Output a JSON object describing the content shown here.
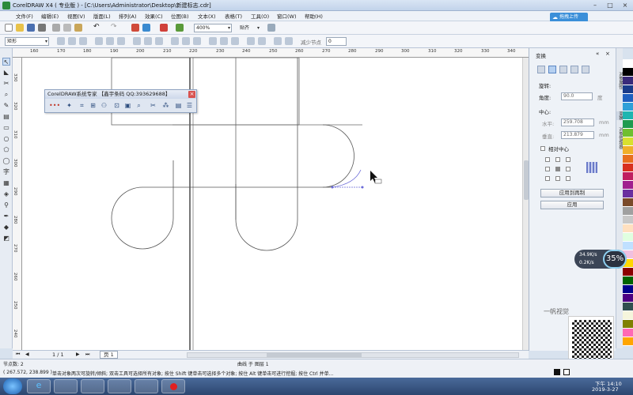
{
  "window": {
    "title": "CorelDRAW X4 ( 专业版 ) - [C:\\Users\\Administrator\\Desktop\\新建标志.cdr]",
    "controls": [
      "–",
      "□",
      "×"
    ]
  },
  "menubar": {
    "items": [
      "文件(F)",
      "编辑(E)",
      "视图(V)",
      "版面(L)",
      "排列(A)",
      "效果(C)",
      "位图(B)",
      "文本(X)",
      "表格(T)",
      "工具(O)",
      "窗口(W)",
      "帮助(H)"
    ]
  },
  "toolbar": {
    "zoom": "400%",
    "snap": "贴齐"
  },
  "propertybar": {
    "object_type": "矩形",
    "nudge_label": "减少节点",
    "nudge_value": "0"
  },
  "upload_button": "拖拽上传",
  "ruler": {
    "h_ticks": [
      "160",
      "170",
      "180",
      "190",
      "200",
      "210",
      "220",
      "230",
      "240",
      "250",
      "260",
      "270",
      "280",
      "290",
      "300",
      "310",
      "320",
      "330",
      "340"
    ],
    "v_ticks": [
      "330",
      "320",
      "310",
      "300",
      "290",
      "280",
      "270",
      "260",
      "250",
      "240"
    ]
  },
  "floating_toolbar": {
    "title": "CorelDRAW系统专家   【鑫宇条码 QQ:393629688】"
  },
  "docker": {
    "title": "变换",
    "rotate_label": "旋转:",
    "angle_label": "角度:",
    "angle_value": "90.0",
    "angle_unit": "度",
    "center_label": "中心:",
    "h_label": "水平:",
    "h_value": "259.708",
    "v_label": "垂直:",
    "v_value": "213.879",
    "unit": "mm",
    "relative_center": "相对中心",
    "apply_to_duplicate": "应用到再制",
    "apply": "应用"
  },
  "side_tabs": [
    "对象属性",
    "变换",
    "对象管理器"
  ],
  "palette_colors": [
    "#ffffff",
    "#000000",
    "#3a2a7a",
    "#1a3b8a",
    "#1f5fbf",
    "#2fa0d8",
    "#1fb5b0",
    "#1f9b4f",
    "#6fbf2f",
    "#d8e02f",
    "#f0b02a",
    "#e8701f",
    "#d8301f",
    "#c01f5f",
    "#a01f8f",
    "#6a2f9f",
    "#7a4a2a",
    "#a0a0a0",
    "#c8c8c8",
    "#ffe0c0",
    "#e0ffe0",
    "#c0e0ff",
    "#f0c0e0",
    "#ffd700",
    "#8b0000",
    "#006400",
    "#00008b",
    "#4b0082",
    "#2f4f4f",
    "#f5f5dc",
    "#808000",
    "#ff69b4",
    "#ffa500"
  ],
  "page_nav": {
    "counter": "1 / 1",
    "tab": "页 1"
  },
  "status": {
    "nodes": "节点数: 2",
    "object": "曲线 于 图层 1",
    "coords": "( 267.572, 238.899 )",
    "hint": "单击对象两次可旋转/倾斜; 双击工具可选择所有对象; 按住 Shift 键单击可选择多个对象; 按住 Alt 键单击可进行挖掘; 按住 Ctrl 并单..."
  },
  "perf_widget": {
    "up": "34.9K/s",
    "down": "0.2K/s",
    "percent": "35%"
  },
  "watermark": "一帆视觉",
  "clock": {
    "time": "下午 14:10",
    "date": "2019-3-27"
  }
}
